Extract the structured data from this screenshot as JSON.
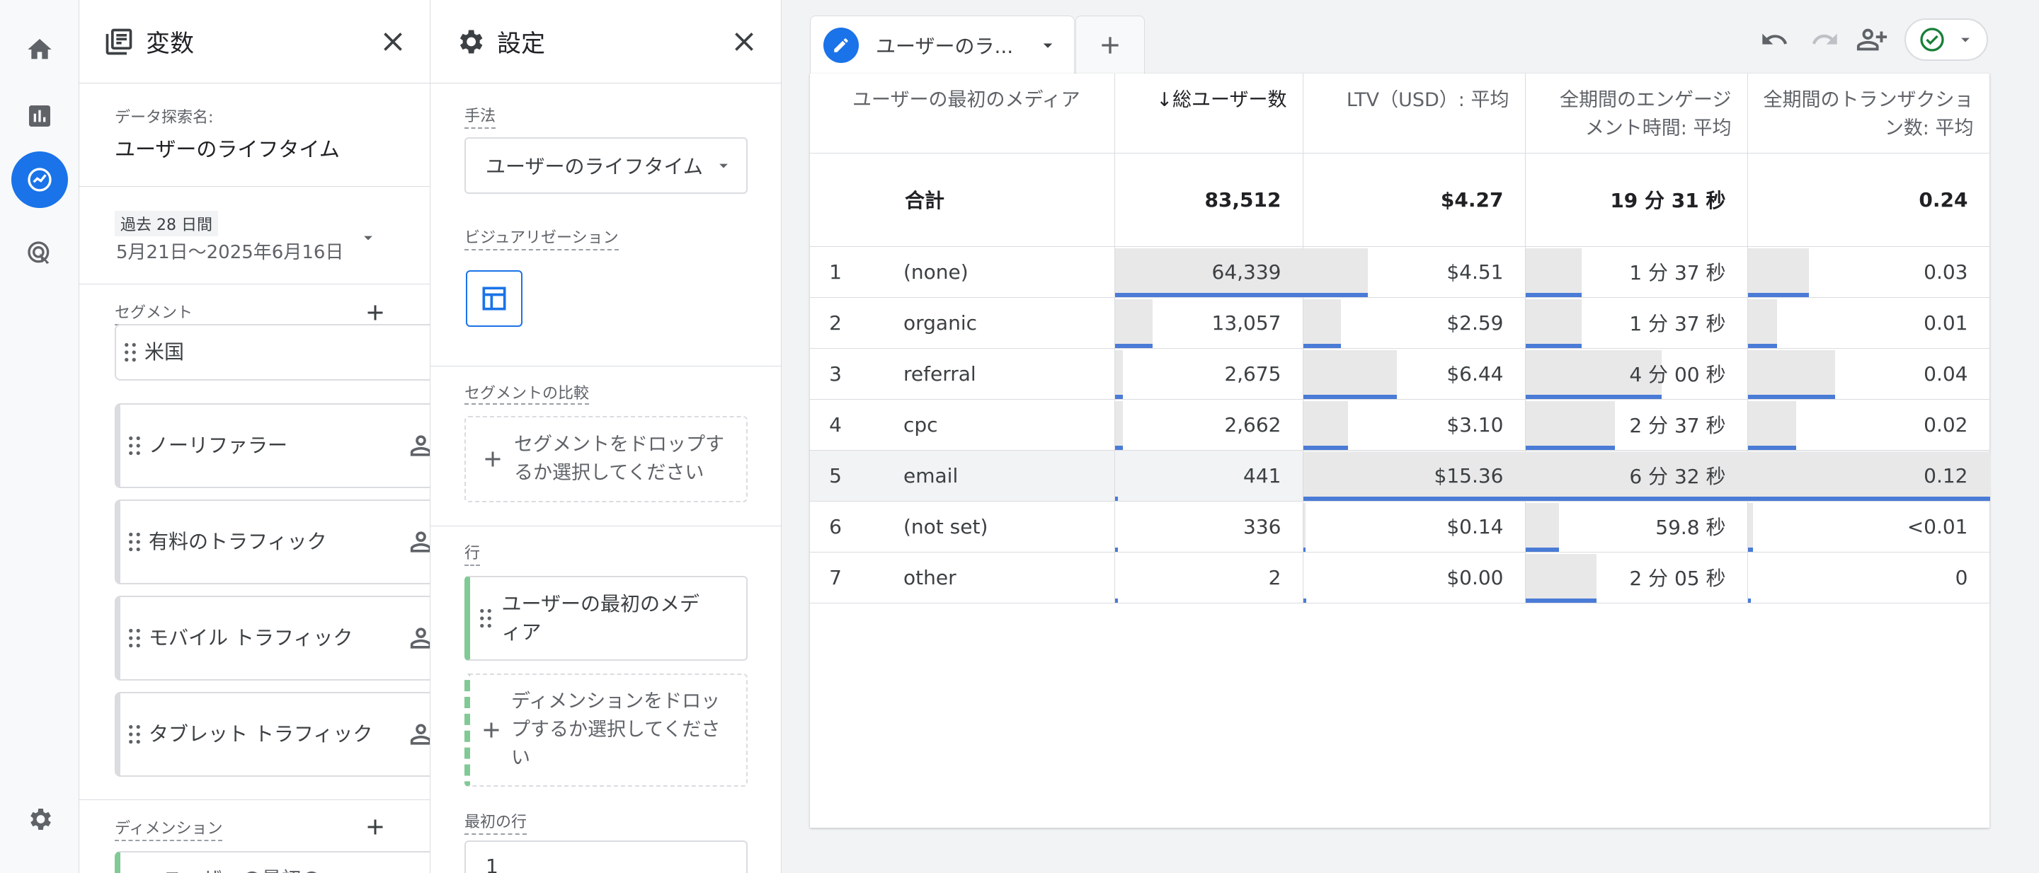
{
  "rail": {
    "items": [
      "home-icon",
      "reports-icon",
      "explore-icon",
      "advertising-icon"
    ],
    "settings": "gear-icon"
  },
  "variables": {
    "title": "変数",
    "name_label": "データ探索名:",
    "name_value": "ユーザーのライフタイム",
    "date_badge": "過去 28 日間",
    "date_range": "5月21日～2025年6月16日",
    "segments_label": "セグメント",
    "segments": [
      "米国",
      "ノーリファラー",
      "有料のトラフィック",
      "モバイル トラフィック",
      "タブレット トラフィック"
    ],
    "dimensions_label": "ディメンション",
    "dimension_first": "ユーザーの最初の"
  },
  "settings": {
    "title": "設定",
    "technique_label": "手法",
    "technique_value": "ユーザーのライフタイム",
    "viz_label": "ビジュアリゼーション",
    "segment_compare_label": "セグメントの比較",
    "segment_drop": "セグメントをドロップするか選択してください",
    "rows_label": "行",
    "row_dimension": "ユーザーの最初のメディア",
    "dimension_drop": "ディメンションをドロップするか選択してください",
    "first_row_label": "最初の行",
    "first_row_value": "1"
  },
  "tabs": {
    "active": "ユーザーのラ..."
  },
  "table": {
    "headers": [
      "ユーザーの最初のメディア",
      "↓総ユーザー数",
      "LTV（USD）: 平均",
      "全期間のエンゲージメント時間: 平均",
      "全期間のトランザクション数: 平均"
    ],
    "total": {
      "label": "合計",
      "users": "83,512",
      "ltv": "$4.27",
      "engagement": "19 分 31 秒",
      "transactions": "0.24"
    },
    "rows": [
      {
        "idx": "1",
        "medium": "(none)",
        "users": "64,339",
        "ltv": "$4.51",
        "engagement": "1 分 37 秒",
        "transactions": "0.03",
        "bars": [
          1.0,
          0.29,
          0.25,
          0.25
        ]
      },
      {
        "idx": "2",
        "medium": "organic",
        "users": "13,057",
        "ltv": "$2.59",
        "engagement": "1 分 37 秒",
        "transactions": "0.01",
        "bars": [
          0.2,
          0.17,
          0.25,
          0.12
        ]
      },
      {
        "idx": "3",
        "medium": "referral",
        "users": "2,675",
        "ltv": "$6.44",
        "engagement": "4 分 00 秒",
        "transactions": "0.04",
        "bars": [
          0.04,
          0.42,
          0.61,
          0.36
        ]
      },
      {
        "idx": "4",
        "medium": "cpc",
        "users": "2,662",
        "ltv": "$3.10",
        "engagement": "2 分 37 秒",
        "transactions": "0.02",
        "bars": [
          0.04,
          0.2,
          0.4,
          0.2
        ]
      },
      {
        "idx": "5",
        "medium": "email",
        "users": "441",
        "ltv": "$15.36",
        "engagement": "6 分 32 秒",
        "transactions": "0.12",
        "bars": [
          0.0,
          1.0,
          1.0,
          1.0
        ]
      },
      {
        "idx": "6",
        "medium": "(not set)",
        "users": "336",
        "ltv": "$0.14",
        "engagement": "59.8 秒",
        "transactions": "<0.01",
        "bars": [
          0.0,
          0.01,
          0.15,
          0.02
        ]
      },
      {
        "idx": "7",
        "medium": "other",
        "users": "2",
        "ltv": "$0.00",
        "engagement": "2 分 05 秒",
        "transactions": "0",
        "bars": [
          0.0,
          0.0,
          0.32,
          0.0
        ]
      }
    ]
  },
  "colors": {
    "accent": "#1a73e8",
    "bar_line": "#4a7bd6",
    "bar_fill": "#e8e8e8",
    "green_check": "#188038",
    "dim_green": "#81c995"
  }
}
